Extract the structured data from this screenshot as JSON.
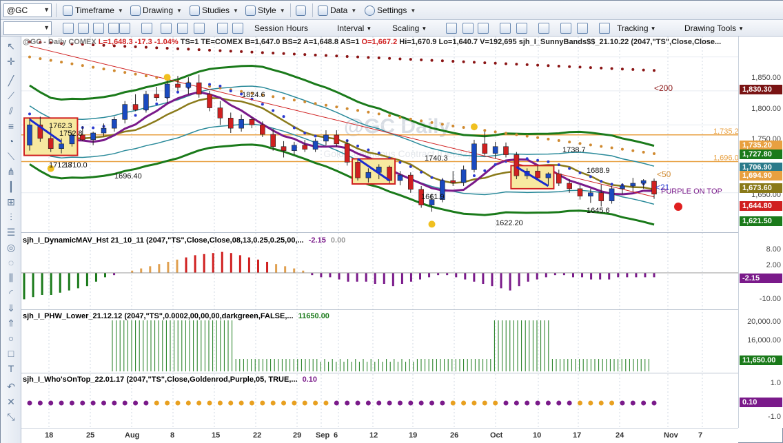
{
  "toolbar": {
    "symbol": "@GC",
    "timeframe": "Timeframe",
    "drawing": "Drawing",
    "studies": "Studies",
    "style": "Style",
    "data": "Data",
    "settings": "Settings"
  },
  "toolbar2": {
    "session_hours": "Session Hours",
    "interval": "Interval",
    "scaling": "Scaling",
    "tracking": "Tracking",
    "drawing_tools": "Drawing Tools"
  },
  "header": {
    "symbol_info": "@GC - Daily  COMEX",
    "last": "L=1,648.3",
    "chg": "-17.3",
    "pct": "-1.04%",
    "ts": "TS=1",
    "te": "TE=COMEX",
    "b": "B=1,647.0",
    "bs": "BS=2",
    "a": "A=1,648.8",
    "as": "AS=1",
    "open": "O=1,667.2",
    "hi": "Hi=1,670.9",
    "lo": "Lo=1,640.7",
    "vol": "V=192,695",
    "study": "sjh_I_SunnyBands$$_21.10.22 (2047,\"TS\",Close,Close..."
  },
  "watermark": {
    "title": "@GC Daily",
    "subtitle": "Gold Continuous Contract [Dec22]"
  },
  "chart_data": {
    "type": "candlestick",
    "title": "@GC Daily",
    "price_labels": [
      {
        "text": "1824.6"
      },
      {
        "text": "1762.3"
      },
      {
        "text": "1752.8"
      },
      {
        "text": "1712.8"
      },
      {
        "text": "1710.0"
      },
      {
        "text": "1696.40"
      },
      {
        "text": "1738.7"
      },
      {
        "text": "1740.3"
      },
      {
        "text": "1688.9"
      },
      {
        "text": "1661.9"
      },
      {
        "text": "1622.20"
      },
      {
        "text": "1645.6"
      }
    ],
    "annotations": [
      "<200",
      "<50",
      "<21",
      "PURPLE ON TOP"
    ],
    "hlines": [
      {
        "label": "1,735.2",
        "color": "#e8a040"
      },
      {
        "label": "1,696.0",
        "color": "#e8a040"
      }
    ],
    "y_ticks": [
      "1,850.00",
      "1,800.00",
      "1,750.00",
      "1,650.00"
    ],
    "x_ticks": [
      "18",
      "25",
      "Aug",
      "8",
      "15",
      "22",
      "29",
      "Sep",
      "6",
      "12",
      "19",
      "26",
      "Oct",
      "10",
      "17",
      "24",
      "Nov",
      "7"
    ],
    "candles": [
      {
        "o": 1720,
        "h": 1760,
        "l": 1712,
        "c": 1750
      },
      {
        "o": 1750,
        "h": 1762,
        "l": 1725,
        "c": 1730
      },
      {
        "o": 1730,
        "h": 1745,
        "l": 1710,
        "c": 1715
      },
      {
        "o": 1715,
        "h": 1730,
        "l": 1708,
        "c": 1722
      },
      {
        "o": 1722,
        "h": 1740,
        "l": 1718,
        "c": 1735
      },
      {
        "o": 1735,
        "h": 1748,
        "l": 1726,
        "c": 1728
      },
      {
        "o": 1728,
        "h": 1740,
        "l": 1720,
        "c": 1738
      },
      {
        "o": 1738,
        "h": 1752,
        "l": 1733,
        "c": 1745
      },
      {
        "o": 1745,
        "h": 1762,
        "l": 1740,
        "c": 1758
      },
      {
        "o": 1758,
        "h": 1785,
        "l": 1752,
        "c": 1780
      },
      {
        "o": 1780,
        "h": 1795,
        "l": 1770,
        "c": 1772
      },
      {
        "o": 1772,
        "h": 1800,
        "l": 1768,
        "c": 1795
      },
      {
        "o": 1795,
        "h": 1806,
        "l": 1785,
        "c": 1790
      },
      {
        "o": 1790,
        "h": 1815,
        "l": 1782,
        "c": 1810
      },
      {
        "o": 1810,
        "h": 1822,
        "l": 1800,
        "c": 1805
      },
      {
        "o": 1805,
        "h": 1820,
        "l": 1795,
        "c": 1812
      },
      {
        "o": 1812,
        "h": 1824,
        "l": 1790,
        "c": 1795
      },
      {
        "o": 1795,
        "h": 1800,
        "l": 1770,
        "c": 1775
      },
      {
        "o": 1775,
        "h": 1785,
        "l": 1750,
        "c": 1760
      },
      {
        "o": 1760,
        "h": 1768,
        "l": 1738,
        "c": 1745
      },
      {
        "o": 1745,
        "h": 1765,
        "l": 1740,
        "c": 1758
      },
      {
        "o": 1758,
        "h": 1762,
        "l": 1745,
        "c": 1750
      },
      {
        "o": 1750,
        "h": 1755,
        "l": 1732,
        "c": 1736
      },
      {
        "o": 1736,
        "h": 1744,
        "l": 1712,
        "c": 1718
      },
      {
        "o": 1718,
        "h": 1726,
        "l": 1702,
        "c": 1712
      },
      {
        "o": 1712,
        "h": 1725,
        "l": 1706,
        "c": 1720
      },
      {
        "o": 1720,
        "h": 1728,
        "l": 1710,
        "c": 1714
      },
      {
        "o": 1714,
        "h": 1730,
        "l": 1710,
        "c": 1726
      },
      {
        "o": 1726,
        "h": 1742,
        "l": 1720,
        "c": 1735
      },
      {
        "o": 1735,
        "h": 1742,
        "l": 1718,
        "c": 1722
      },
      {
        "o": 1722,
        "h": 1728,
        "l": 1690,
        "c": 1695
      },
      {
        "o": 1695,
        "h": 1700,
        "l": 1668,
        "c": 1672
      },
      {
        "o": 1672,
        "h": 1686,
        "l": 1665,
        "c": 1680
      },
      {
        "o": 1680,
        "h": 1692,
        "l": 1670,
        "c": 1688
      },
      {
        "o": 1688,
        "h": 1690,
        "l": 1664,
        "c": 1668
      },
      {
        "o": 1668,
        "h": 1682,
        "l": 1661,
        "c": 1676
      },
      {
        "o": 1676,
        "h": 1680,
        "l": 1650,
        "c": 1655
      },
      {
        "o": 1655,
        "h": 1660,
        "l": 1628,
        "c": 1632
      },
      {
        "o": 1632,
        "h": 1648,
        "l": 1622,
        "c": 1640
      },
      {
        "o": 1640,
        "h": 1672,
        "l": 1636,
        "c": 1668
      },
      {
        "o": 1668,
        "h": 1682,
        "l": 1660,
        "c": 1665
      },
      {
        "o": 1665,
        "h": 1690,
        "l": 1660,
        "c": 1684
      },
      {
        "o": 1684,
        "h": 1728,
        "l": 1680,
        "c": 1722
      },
      {
        "o": 1722,
        "h": 1740,
        "l": 1705,
        "c": 1708
      },
      {
        "o": 1708,
        "h": 1725,
        "l": 1700,
        "c": 1718
      },
      {
        "o": 1718,
        "h": 1724,
        "l": 1702,
        "c": 1706
      },
      {
        "o": 1706,
        "h": 1710,
        "l": 1670,
        "c": 1675
      },
      {
        "o": 1675,
        "h": 1686,
        "l": 1670,
        "c": 1682
      },
      {
        "o": 1682,
        "h": 1690,
        "l": 1668,
        "c": 1672
      },
      {
        "o": 1672,
        "h": 1680,
        "l": 1660,
        "c": 1678
      },
      {
        "o": 1678,
        "h": 1684,
        "l": 1660,
        "c": 1664
      },
      {
        "o": 1664,
        "h": 1670,
        "l": 1650,
        "c": 1656
      },
      {
        "o": 1656,
        "h": 1662,
        "l": 1640,
        "c": 1645
      },
      {
        "o": 1645,
        "h": 1656,
        "l": 1635,
        "c": 1650
      },
      {
        "o": 1650,
        "h": 1662,
        "l": 1630,
        "c": 1638
      },
      {
        "o": 1638,
        "h": 1660,
        "l": 1634,
        "c": 1656
      },
      {
        "o": 1656,
        "h": 1664,
        "l": 1648,
        "c": 1660
      },
      {
        "o": 1660,
        "h": 1672,
        "l": 1652,
        "c": 1664
      },
      {
        "o": 1664,
        "h": 1670,
        "l": 1656,
        "c": 1668
      },
      {
        "o": 1667,
        "h": 1671,
        "l": 1641,
        "c": 1648
      }
    ]
  },
  "panes": {
    "p2": {
      "title": "sjh_I_DynamicMAV_Hst 21_10_11 (2047,\"TS\",Close,Close,08,13,0.25,0.25,00,...",
      "val1": "-2.15",
      "val2": "0.00",
      "ticks": [
        "8.00",
        "2.00",
        "-10.00"
      ],
      "badge": "-2.15",
      "values": [
        -12,
        -11,
        -10,
        -10,
        -9,
        -8,
        -7,
        -6,
        -4,
        -2,
        -1,
        0,
        1,
        2,
        3,
        4,
        5,
        6,
        7,
        8,
        8.5,
        9,
        9.5,
        9,
        8,
        7,
        6,
        5,
        4,
        3,
        2,
        1,
        -1,
        -2,
        -2,
        -3,
        -4,
        -4,
        -4,
        -5,
        -5,
        -6,
        -5,
        -4,
        -3,
        -2,
        -1,
        -1,
        -2,
        -3,
        -4,
        -5,
        -6,
        -7,
        -8,
        -6,
        -4,
        -3,
        -2,
        -1,
        -1,
        -2,
        -2,
        -3,
        -3,
        -3,
        -2,
        -2,
        -2,
        -2,
        -2
      ]
    },
    "p3": {
      "title": "sjh_I_PHW_Lower_21.12.12 (2047,\"TS\",0.0002,00,00,00,darkgreen,FALSE,...",
      "val": "11650.00",
      "ticks": [
        "20,000.00",
        "16,000.00"
      ],
      "badge": "11,650.00"
    },
    "p4": {
      "title": "sjh_I_Who'sOnTop_22.01.17 (2047,\"TS\",Close,Goldenrod,Purple,05, TRUE,...",
      "val": "0.10",
      "ticks": [
        "1.0",
        "-1.0"
      ],
      "badge": "0.10"
    }
  },
  "price_badges": [
    {
      "text": "1,830.30",
      "color": "#7a1414"
    },
    {
      "text": "1,735.20",
      "color": "#e8a040"
    },
    {
      "text": "1,727.80",
      "color": "#1a7a1a"
    },
    {
      "text": "1,706.90",
      "color": "#2a7a8a"
    },
    {
      "text": "1,694.90",
      "color": "#e8a040"
    },
    {
      "text": "1,673.60",
      "color": "#8a7a1a"
    },
    {
      "text": "1,644.80",
      "color": "#d02020"
    },
    {
      "text": "1,621.50",
      "color": "#1a7a1a"
    }
  ]
}
